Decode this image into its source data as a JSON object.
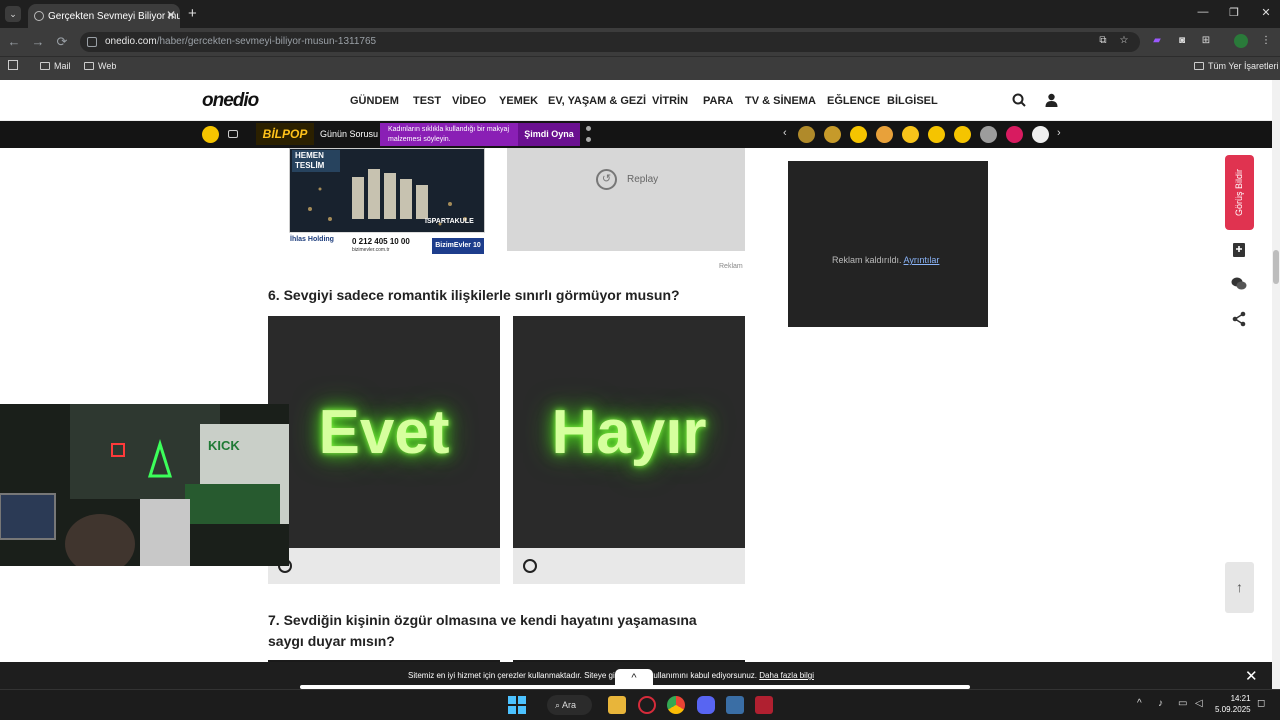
{
  "browser": {
    "tab_title": "Gerçekten Sevmeyi Biliyor musu",
    "tab_close": "✕",
    "new_tab": "+",
    "tab_list": "⌄",
    "window_min": "—",
    "window_max": "❐",
    "window_close": "✕",
    "back": "←",
    "forward": "→",
    "reload": "⟳",
    "url_host": "onedio.com",
    "url_path": "/haber/gercekten-sevmeyi-biliyor-musun-1311765",
    "bookmarks": [
      {
        "label": "Mail"
      },
      {
        "label": "Web"
      }
    ],
    "all_bookmarks": "Tüm Yer İşaretleri"
  },
  "site": {
    "logo": "onedio",
    "nav": [
      "GÜNDEM",
      "TEST",
      "VİDEO",
      "YEMEK",
      "EV, YAŞAM & GEZİ",
      "VİTRİN",
      "PARA",
      "TV & SİNEMA",
      "EĞLENCE",
      "BİLGİSEL"
    ]
  },
  "gamebar": {
    "brand": "BİLPOP",
    "daily_label": "Günün Sorusu",
    "question": "Kadınların sıklıkla kullandığı bir makyaj malzemesi söyleyin.",
    "play_label": "Şimdi Oyna",
    "prev": "‹",
    "next": "›",
    "emoji_colors": [
      "#b08a2a",
      "#c69a2a",
      "#f5c400",
      "#e8a13a",
      "#f7c31a",
      "#f5c400",
      "#f5c400",
      "#9c9c9c",
      "#d81b60",
      "#eeeeee"
    ]
  },
  "article": {
    "ad": {
      "hemen": "HEMEN TESLİM",
      "location": "ISPARTAKULE",
      "phone": "0 212 405 10 00",
      "website": "bizimevler.com.tr",
      "company": "İhlas Holding",
      "brand": "BizimEvler 10"
    },
    "replay_label": "Replay",
    "ad_label": "Reklam",
    "q6": "6. Sevgiyi sadece romantik ilişkilerle sınırlı görmüyor musun?",
    "q6_options": [
      "Evet",
      "Hayır"
    ],
    "q7": "7. Sevdiğin kişinin özgür olmasına ve kendi hayatını yaşamasına saygı duyar mısın?"
  },
  "sidebar": {
    "ad_removed_text": "Reklam kaldırıldı.",
    "ad_details_link": "Ayrıntılar",
    "feedback_label": "Görüş Bildir",
    "to_top": "↑"
  },
  "cookie": {
    "text": "Sitemiz en iyi hizmet için çerezler kullanmaktadır. Siteye gir… çerez kullanımını kabul ediyorsunuz.",
    "link": "Daha fazla bilgi",
    "close": "✕",
    "up": "^"
  },
  "taskbar": {
    "search_label": "Ara",
    "time": "14:21",
    "date": "5.09.2025",
    "tray_caret": "^"
  }
}
